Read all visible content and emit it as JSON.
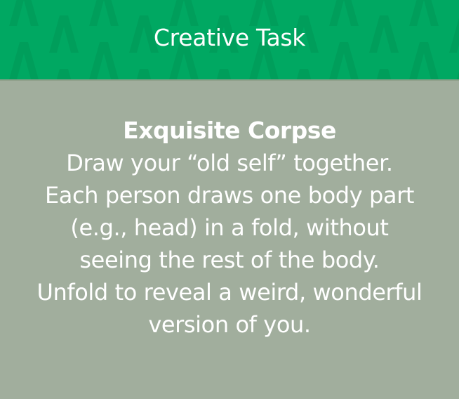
{
  "header": {
    "title": "Creative Task",
    "pattern_icon": "caret-up-pattern-icon"
  },
  "colors": {
    "header_bg": "#00a862",
    "pattern": "#009e5b",
    "body_bg": "#a1ae9d",
    "text": "#ffffff"
  },
  "task": {
    "name": "Exquisite Corpse",
    "lines": [
      "Draw your “old self” together.",
      "Each person draws one body part",
      "(e.g., head) in a fold, without",
      "seeing the rest of the body.",
      "Unfold to reveal a weird, wonderful",
      "version of you."
    ]
  }
}
